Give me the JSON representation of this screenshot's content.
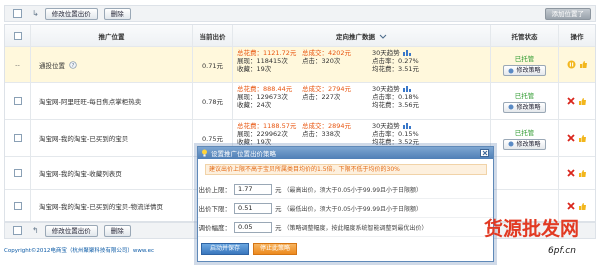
{
  "toolbar": {
    "modify_bid_label": "修改位置出价",
    "delete_label": "删除",
    "add_position_label": "添加位置了"
  },
  "table": {
    "headers": {
      "position": "推广位置",
      "current_bid": "当前出价",
      "data": "定向推广数据",
      "status": "托管状态",
      "action": "操作"
    },
    "rows": [
      {
        "check": "--",
        "position": "通投位置",
        "bid": "0.71元",
        "spend": "总花费：1121.72元",
        "deals": "总成交：4202元",
        "roi_days": "30天趋势",
        "impressions": "展现：118415次",
        "clicks": "点击：320次",
        "ctr": "点击率：0.27%",
        "favs": "收藏：19次",
        "avg": "均花费：3.51元",
        "status": "已托管",
        "status_btn": "修改策略"
      },
      {
        "position": "淘宝网-阿里旺旺-每日焦点掌柜热卖",
        "bid": "0.78元",
        "spend": "总花费：888.44元",
        "deals": "总成交：2794元",
        "roi_days": "30天趋势",
        "impressions": "展现：129673次",
        "clicks": "点击：227次",
        "ctr": "点击率：0.18%",
        "favs": "收藏：24次",
        "avg": "均花费：3.56元",
        "status": "已托管",
        "status_btn": "修改策略"
      },
      {
        "position": "淘宝网-我的淘宝-已买到的宝贝",
        "bid": "0.75元",
        "spend": "总花费：1188.57元",
        "deals": "总成交：2894元",
        "roi_days": "30天趋势",
        "impressions": "展现：229962次",
        "clicks": "点击：338次",
        "ctr": "点击率：0.15%",
        "favs": "收藏：19次",
        "avg": "均花费：3.52元",
        "status": "已托管",
        "status_btn": "修改策略"
      },
      {
        "position": "淘宝网-我的淘宝-收藏列表页",
        "bid": "",
        "spend": "",
        "deals": "",
        "roi_days": "",
        "impressions": "",
        "clicks": "",
        "ctr": "",
        "favs": "",
        "avg": "",
        "status": "",
        "status_btn": ""
      },
      {
        "position": "淘宝网-我的淘宝-已买到的宝贝-物流详情页",
        "bid": "",
        "spend": "",
        "deals": "",
        "roi_days": "",
        "impressions": "",
        "clicks": "",
        "ctr": "",
        "favs": "",
        "avg": "",
        "status": "",
        "status_btn": ""
      }
    ]
  },
  "dialog": {
    "title": "设置推广位置出价策略",
    "warning": "建议出价上限不高于宝贝所属类目均价的1.5倍，下限不低于均价的30%",
    "max_bid": {
      "label": "出价上限：",
      "value": "1.77",
      "unit": "元",
      "note": "（最高出价，须大于0.05小于99.99且小于日限额）"
    },
    "min_bid": {
      "label": "出价下限：",
      "value": "0.51",
      "unit": "元",
      "note": "（最低出价，须大于0.05小于99.99且小于日限额）"
    },
    "adjust": {
      "label": "调价幅度：",
      "value": "0.05",
      "unit": "元",
      "note": "（策略调整幅度，按此幅度系统智能调整到最优出价）"
    },
    "save_label": "启动并保存",
    "stop_label": "停止此策略"
  },
  "footer": {
    "copyright": "Copyright©2012电商宝（杭州聚聚科技有限公司）www.ec"
  },
  "watermark": {
    "text": "货源批发网",
    "url": "6pf.cn"
  },
  "colors": {
    "accent_orange": "#e8550f",
    "status_green": "#2e9a2e",
    "dialog_blue": "#4f7fb6",
    "row_highlight": "#fff8dc"
  }
}
